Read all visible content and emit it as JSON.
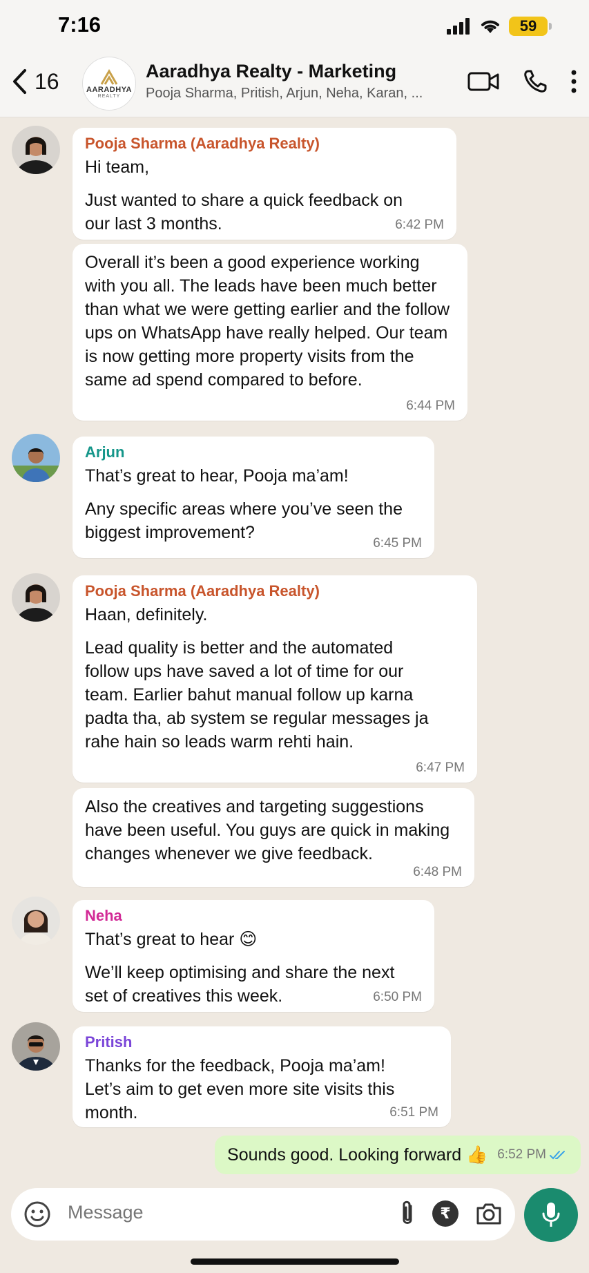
{
  "status": {
    "time": "7:16",
    "battery": "59"
  },
  "header": {
    "back_count": "16",
    "avatar_brand": "AARADHYA",
    "avatar_sub": "REALTY",
    "title": "Aaradhya Realty - Marketing",
    "members": "Pooja Sharma, Pritish, Arjun, Neha, Karan, ..."
  },
  "colors": {
    "pooja": "#c8552c",
    "arjun": "#15968a",
    "neha": "#d22a96",
    "pritish": "#7a45d8",
    "accent": "#1a8b6e",
    "read_ticks": "#3aa4e8"
  },
  "messages": [
    {
      "sender": "Pooja Sharma (Aaradhya Realty)",
      "lines": [
        "Hi team,",
        "Just wanted to share a quick feedback on our last 3 months."
      ],
      "time": "6:42 PM"
    },
    {
      "sender": "",
      "lines": [
        "Overall it’s been a good experience working with you all. The leads have been much better than what we were getting earlier and the follow ups on WhatsApp have really helped. Our team is now getting more property visits from the same ad spend compared to before."
      ],
      "time": "6:44 PM"
    },
    {
      "sender": "Arjun",
      "lines": [
        "That’s great to hear, Pooja ma’am!",
        "Any specific areas where you’ve seen the biggest improvement?"
      ],
      "time": "6:45 PM"
    },
    {
      "sender": "Pooja Sharma (Aaradhya Realty)",
      "lines": [
        "Haan, definitely.",
        "Lead quality is better and the automated follow ups have saved a lot of time for our team. Earlier bahut manual follow up karna padta tha, ab system se regular messages ja rahe hain so leads warm rehti hain."
      ],
      "time": "6:47 PM"
    },
    {
      "sender": "",
      "lines": [
        "Also the creatives and targeting suggestions have been useful. You guys are quick in making changes whenever we give feedback."
      ],
      "time": "6:48 PM"
    },
    {
      "sender": "Neha",
      "lines": [
        "That’s great to hear 😊",
        "We’ll keep optimising and share the next set of creatives this week."
      ],
      "time": "6:50 PM"
    },
    {
      "sender": "Pritish",
      "lines": [
        "Thanks for the feedback, Pooja ma’am! Let’s aim to get even more site visits this month."
      ],
      "time": "6:51 PM"
    }
  ],
  "outgoing": {
    "text": "Sounds good. Looking forward 👍",
    "time": "6:52 PM"
  },
  "input": {
    "placeholder": "Message",
    "rupee": "₹"
  }
}
